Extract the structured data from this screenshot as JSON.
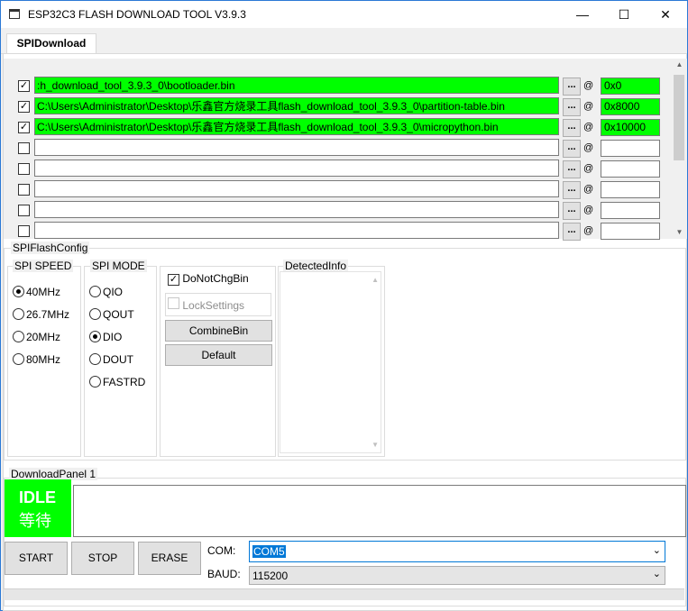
{
  "window": {
    "title": "ESP32C3 FLASH DOWNLOAD TOOL V3.9.3",
    "controls": {
      "minimize": "—",
      "maximize": "☐",
      "close": "✕"
    }
  },
  "tabs": [
    {
      "label": "SPIDownload",
      "active": true
    }
  ],
  "files": [
    {
      "checked": true,
      "path": ":h_download_tool_3.9.3_0\\bootloader.bin",
      "address": "0x0",
      "highlight": true
    },
    {
      "checked": true,
      "path": "C:\\Users\\Administrator\\Desktop\\乐鑫官方烧录工具flash_download_tool_3.9.3_0\\partition-table.bin",
      "address": "0x8000",
      "highlight": true
    },
    {
      "checked": true,
      "path": "C:\\Users\\Administrator\\Desktop\\乐鑫官方烧录工具flash_download_tool_3.9.3_0\\micropython.bin",
      "address": "0x10000",
      "highlight": true
    },
    {
      "checked": false,
      "path": "",
      "address": "",
      "highlight": false
    },
    {
      "checked": false,
      "path": "",
      "address": "",
      "highlight": false
    },
    {
      "checked": false,
      "path": "",
      "address": "",
      "highlight": false
    },
    {
      "checked": false,
      "path": "",
      "address": "",
      "highlight": false
    },
    {
      "checked": false,
      "path": "",
      "address": "",
      "highlight": false
    }
  ],
  "browse_label": "...",
  "at_label": "@",
  "spi_flash_config": {
    "title": "SPIFlashConfig",
    "spi_speed": {
      "title": "SPI SPEED",
      "options": [
        "40MHz",
        "26.7MHz",
        "20MHz",
        "80MHz"
      ],
      "selected": "40MHz"
    },
    "spi_mode": {
      "title": "SPI MODE",
      "options": [
        "QIO",
        "QOUT",
        "DIO",
        "DOUT",
        "FASTRD"
      ],
      "selected": "DIO"
    },
    "do_not_chg_bin": {
      "label": "DoNotChgBin",
      "checked": true
    },
    "lock_settings": {
      "label": "LockSettings",
      "checked": false,
      "disabled": true
    },
    "combine_bin": "CombineBin",
    "default": "Default",
    "detected_info": {
      "title": "DetectedInfo"
    }
  },
  "download_panel": {
    "title": "DownloadPanel 1",
    "status_en": "IDLE",
    "status_cn": "等待",
    "status_color": "#00ff00",
    "log": ""
  },
  "actions": {
    "start": "START",
    "stop": "STOP",
    "erase": "ERASE"
  },
  "com": {
    "label": "COM:",
    "value": "COM5"
  },
  "baud": {
    "label": "BAUD:",
    "value": "115200"
  }
}
